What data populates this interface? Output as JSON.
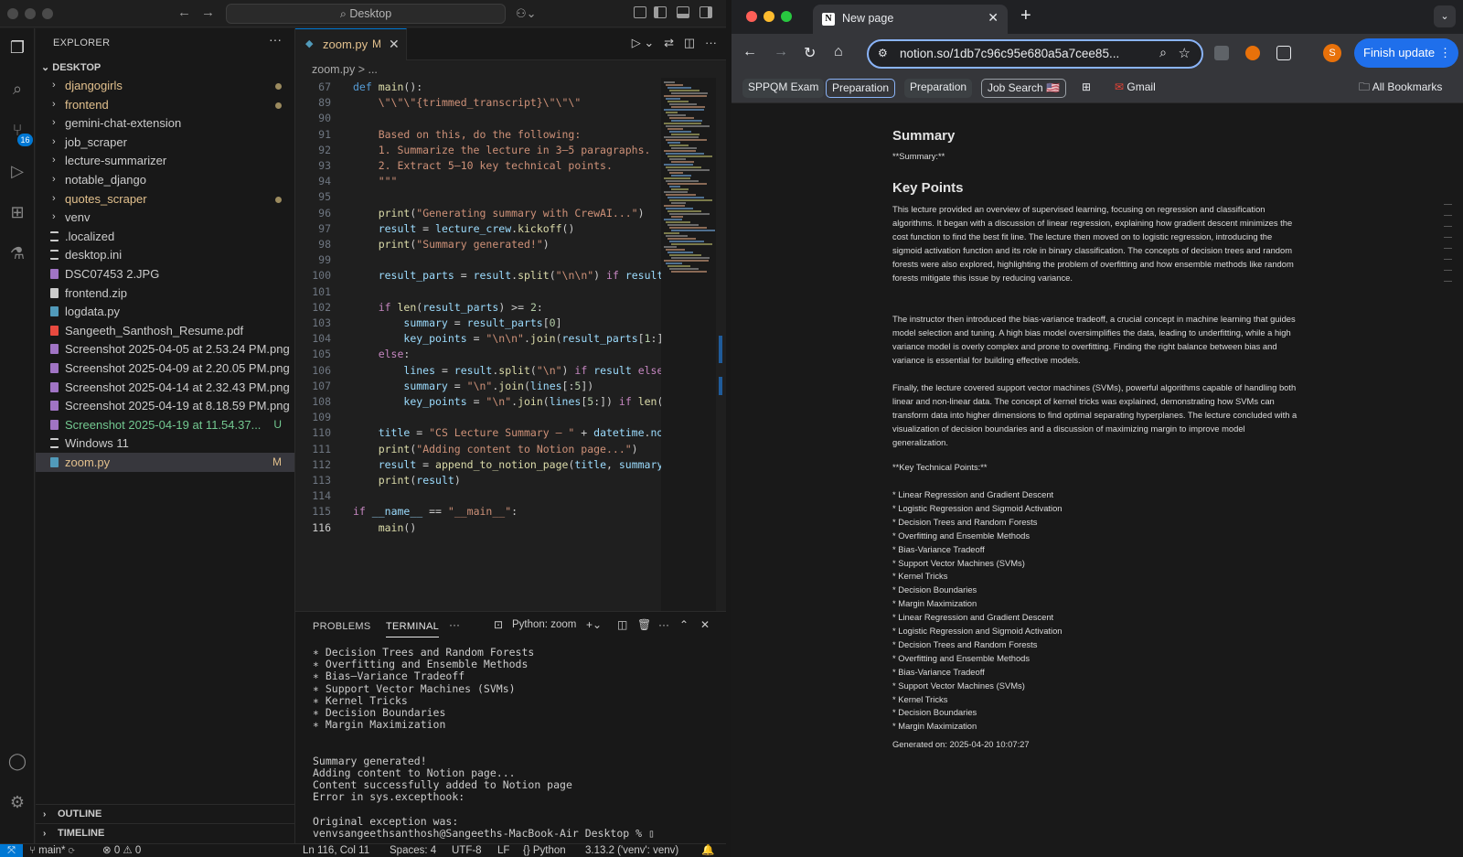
{
  "vscode": {
    "search_label": "Desktop",
    "explorer_title": "EXPLORER",
    "root_folder": "DESKTOP",
    "scm_badge": "16",
    "tree": [
      {
        "label": "djangogirls",
        "kind": "folder",
        "color": "#e2c08d",
        "dot": true
      },
      {
        "label": "frontend",
        "kind": "folder",
        "color": "#e2c08d",
        "dot": true
      },
      {
        "label": "gemini-chat-extension",
        "kind": "folder",
        "color": "#cccccc"
      },
      {
        "label": "job_scraper",
        "kind": "folder",
        "color": "#cccccc"
      },
      {
        "label": "lecture-summarizer",
        "kind": "folder",
        "color": "#cccccc"
      },
      {
        "label": "notable_django",
        "kind": "folder",
        "color": "#cccccc"
      },
      {
        "label": "quotes_scraper",
        "kind": "folder",
        "color": "#e2c08d",
        "dot": true
      },
      {
        "label": "venv",
        "kind": "folder",
        "color": "#cccccc"
      },
      {
        "label": ".localized",
        "kind": "file",
        "color": "#cccccc"
      },
      {
        "label": "desktop.ini",
        "kind": "file",
        "color": "#cccccc"
      },
      {
        "label": "DSC07453 2.JPG",
        "kind": "image",
        "color": "#cccccc"
      },
      {
        "label": "frontend.zip",
        "kind": "zip",
        "color": "#cccccc"
      },
      {
        "label": "logdata.py",
        "kind": "py",
        "color": "#cccccc"
      },
      {
        "label": "Sangeeth_Santhosh_Resume.pdf",
        "kind": "pdf",
        "color": "#cccccc"
      },
      {
        "label": "Screenshot 2025-04-05 at 2.53.24 PM.png",
        "kind": "image",
        "color": "#cccccc"
      },
      {
        "label": "Screenshot 2025-04-09 at 2.20.05 PM.png",
        "kind": "image",
        "color": "#cccccc"
      },
      {
        "label": "Screenshot 2025-04-14 at 2.32.43 PM.png",
        "kind": "image",
        "color": "#cccccc"
      },
      {
        "label": "Screenshot 2025-04-19 at 8.18.59 PM.png",
        "kind": "image",
        "color": "#cccccc"
      },
      {
        "label": "Screenshot 2025-04-19 at 11.54.37...",
        "kind": "image",
        "color": "#73c991",
        "status": "U"
      },
      {
        "label": "Windows 11",
        "kind": "file",
        "color": "#cccccc"
      },
      {
        "label": "zoom.py",
        "kind": "py",
        "color": "#e2c08d",
        "status": "M",
        "selected": true
      }
    ],
    "outline_label": "OUTLINE",
    "timeline_label": "TIMELINE",
    "tab": {
      "name": "zoom.py",
      "modified": "M"
    },
    "breadcrumb": "zoom.py > ...",
    "code_lines": [
      {
        "n": "67",
        "html": "<span class='kw'>def</span> <span class='fn'>main</span>():"
      },
      {
        "n": "89",
        "html": "    <span class='str'>\\\"\\\"\\\"{trimmed_transcript}\\\"\\\"\\\"</span>"
      },
      {
        "n": "90",
        "html": ""
      },
      {
        "n": "91",
        "html": "    <span class='str'>Based on this, do the following:</span>"
      },
      {
        "n": "92",
        "html": "    <span class='str'>1. Summarize the lecture in 3–5 paragraphs.</span>"
      },
      {
        "n": "93",
        "html": "    <span class='str'>2. Extract 5–10 key technical points.</span>"
      },
      {
        "n": "94",
        "html": "    <span class='str'>\"\"\"</span>"
      },
      {
        "n": "95",
        "html": ""
      },
      {
        "n": "96",
        "html": "    <span class='fn'>print</span>(<span class='str'>\"Generating summary with CrewAI...\"</span>)"
      },
      {
        "n": "97",
        "html": "    <span class='var'>result</span> = <span class='var'>lecture_crew</span>.<span class='fn'>kickoff</span>()"
      },
      {
        "n": "98",
        "html": "    <span class='fn'>print</span>(<span class='str'>\"Summary generated!\"</span>)"
      },
      {
        "n": "99",
        "html": ""
      },
      {
        "n": "100",
        "html": "    <span class='var'>result_parts</span> = <span class='var'>result</span>.<span class='fn'>split</span>(<span class='str'>\"\\n\\n\"</span>) <span class='kw2'>if</span> <span class='var'>result</span>"
      },
      {
        "n": "101",
        "html": ""
      },
      {
        "n": "102",
        "html": "    <span class='kw2'>if</span> <span class='fn'>len</span>(<span class='var'>result_parts</span>) &gt;= <span class='num'>2</span>:"
      },
      {
        "n": "103",
        "html": "        <span class='var'>summary</span> = <span class='var'>result_parts</span>[<span class='num'>0</span>]"
      },
      {
        "n": "104",
        "html": "        <span class='var'>key_points</span> = <span class='str'>\"\\n\\n\"</span>.<span class='fn'>join</span>(<span class='var'>result_parts</span>[<span class='num'>1</span>:])"
      },
      {
        "n": "105",
        "html": "    <span class='kw2'>else</span>:"
      },
      {
        "n": "106",
        "html": "        <span class='var'>lines</span> = <span class='var'>result</span>.<span class='fn'>split</span>(<span class='str'>\"\\n\"</span>) <span class='kw2'>if</span> <span class='var'>result</span> <span class='kw2'>else</span>"
      },
      {
        "n": "107",
        "html": "        <span class='var'>summary</span> = <span class='str'>\"\\n\"</span>.<span class='fn'>join</span>(<span class='var'>lines</span>[:<span class='num'>5</span>])"
      },
      {
        "n": "108",
        "html": "        <span class='var'>key_points</span> = <span class='str'>\"\\n\"</span>.<span class='fn'>join</span>(<span class='var'>lines</span>[<span class='num'>5</span>:]) <span class='kw2'>if</span> <span class='fn'>len</span>("
      },
      {
        "n": "109",
        "html": ""
      },
      {
        "n": "110",
        "html": "    <span class='var'>title</span> = <span class='str'>\"CS Lecture Summary – \"</span> + <span class='var'>datetime</span>.<span class='var'>now</span>"
      },
      {
        "n": "111",
        "html": "    <span class='fn'>print</span>(<span class='str'>\"Adding content to Notion page...\"</span>)"
      },
      {
        "n": "112",
        "html": "    <span class='var'>result</span> = <span class='fn'>append_to_notion_page</span>(<span class='var'>title</span>, <span class='var'>summary</span>,"
      },
      {
        "n": "113",
        "html": "    <span class='fn'>print</span>(<span class='var'>result</span>)"
      },
      {
        "n": "114",
        "html": ""
      },
      {
        "n": "115",
        "html": "<span class='kw2'>if</span> <span class='var'>__name__</span> == <span class='str'>\"__main__\"</span>:"
      },
      {
        "n": "116",
        "html": "    <span class='fn'>main</span>()",
        "current": true
      }
    ],
    "panel_tabs": {
      "problems": "PROBLEMS",
      "terminal": "TERMINAL"
    },
    "terminal_profile": "Python: zoom",
    "terminal_output": "∗ Decision Trees and Random Forests\n∗ Overfitting and Ensemble Methods\n∗ Bias–Variance Tradeoff\n∗ Support Vector Machines (SVMs)\n∗ Kernel Tricks\n∗ Decision Boundaries\n∗ Margin Maximization\n\n\nSummary generated!\nAdding content to Notion page...\nContent successfully added to Notion page\nError in sys.excepthook:\n\nOriginal exception was:\nvenvsangeethsanthosh@Sangeeths-MacBook-Air Desktop % ▯",
    "status": {
      "branch": "main*",
      "problems": "⊗ 0 ⚠ 0",
      "position": "Ln 116, Col 11",
      "spaces": "Spaces: 4",
      "encoding": "UTF-8",
      "eol": "LF",
      "language": "{} Python",
      "interpreter": "3.13.2 ('venv': venv)"
    }
  },
  "chrome": {
    "tab_title": "New page",
    "url": "notion.so/1db7c96c95e680a5a7cee85...",
    "avatar_letter": "S",
    "finish_update": "Finish update",
    "bookmarks": [
      {
        "label": "SPPQM Exam",
        "style": "green"
      },
      {
        "label": "Preparation",
        "style": "outline-b"
      },
      {
        "label": "Preparation",
        "style": "green"
      },
      {
        "label": "Job Search 🇺🇸",
        "style": "outline-g"
      }
    ],
    "gmail": "Gmail",
    "all_bookmarks": "All Bookmarks"
  },
  "notion": {
    "summary_heading": "Summary",
    "summary_marker": "**Summary:**",
    "key_points_heading": "Key Points",
    "paragraphs": [
      "This lecture provided an overview of supervised learning, focusing on regression and classification algorithms.  It began with a discussion of linear regression, explaining how gradient descent minimizes the cost function to find the best fit line.  The lecture then moved on to logistic regression, introducing the sigmoid activation function and its role in binary classification.  The concepts of decision trees and random forests were also explored, highlighting the problem of overfitting and how ensemble methods like random forests mitigate this issue by reducing variance.",
      "The instructor then introduced the bias-variance tradeoff, a crucial concept in machine learning that guides model selection and tuning.  A high bias model oversimplifies the data, leading to underfitting, while a high variance model is overly complex and prone to overfitting.  Finding the right balance between bias and variance is essential for building effective models.",
      "Finally, the lecture covered support vector machines (SVMs), powerful algorithms capable of handling both linear and non-linear data.  The concept of kernel tricks was explained, demonstrating how SVMs can transform data into higher dimensions to find optimal separating hyperplanes.  The lecture concluded with a visualization of decision boundaries and a discussion of maximizing margin to improve model generalization."
    ],
    "key_marker": "**Key Technical Points:**",
    "points": [
      "* Linear Regression and Gradient Descent",
      "* Logistic Regression and Sigmoid Activation",
      "* Decision Trees and Random Forests",
      "* Overfitting and Ensemble Methods",
      "* Bias-Variance Tradeoff",
      "* Support Vector Machines (SVMs)",
      "* Kernel Tricks",
      "* Decision Boundaries",
      "* Margin Maximization",
      "* Linear Regression and Gradient Descent",
      "* Logistic Regression and Sigmoid Activation",
      "* Decision Trees and Random Forests",
      "* Overfitting and Ensemble Methods",
      "* Bias-Variance Tradeoff",
      "* Support Vector Machines (SVMs)",
      "* Kernel Tricks",
      "* Decision Boundaries",
      "* Margin Maximization"
    ],
    "generated": "Generated on: 2025-04-20 10:07:27"
  }
}
